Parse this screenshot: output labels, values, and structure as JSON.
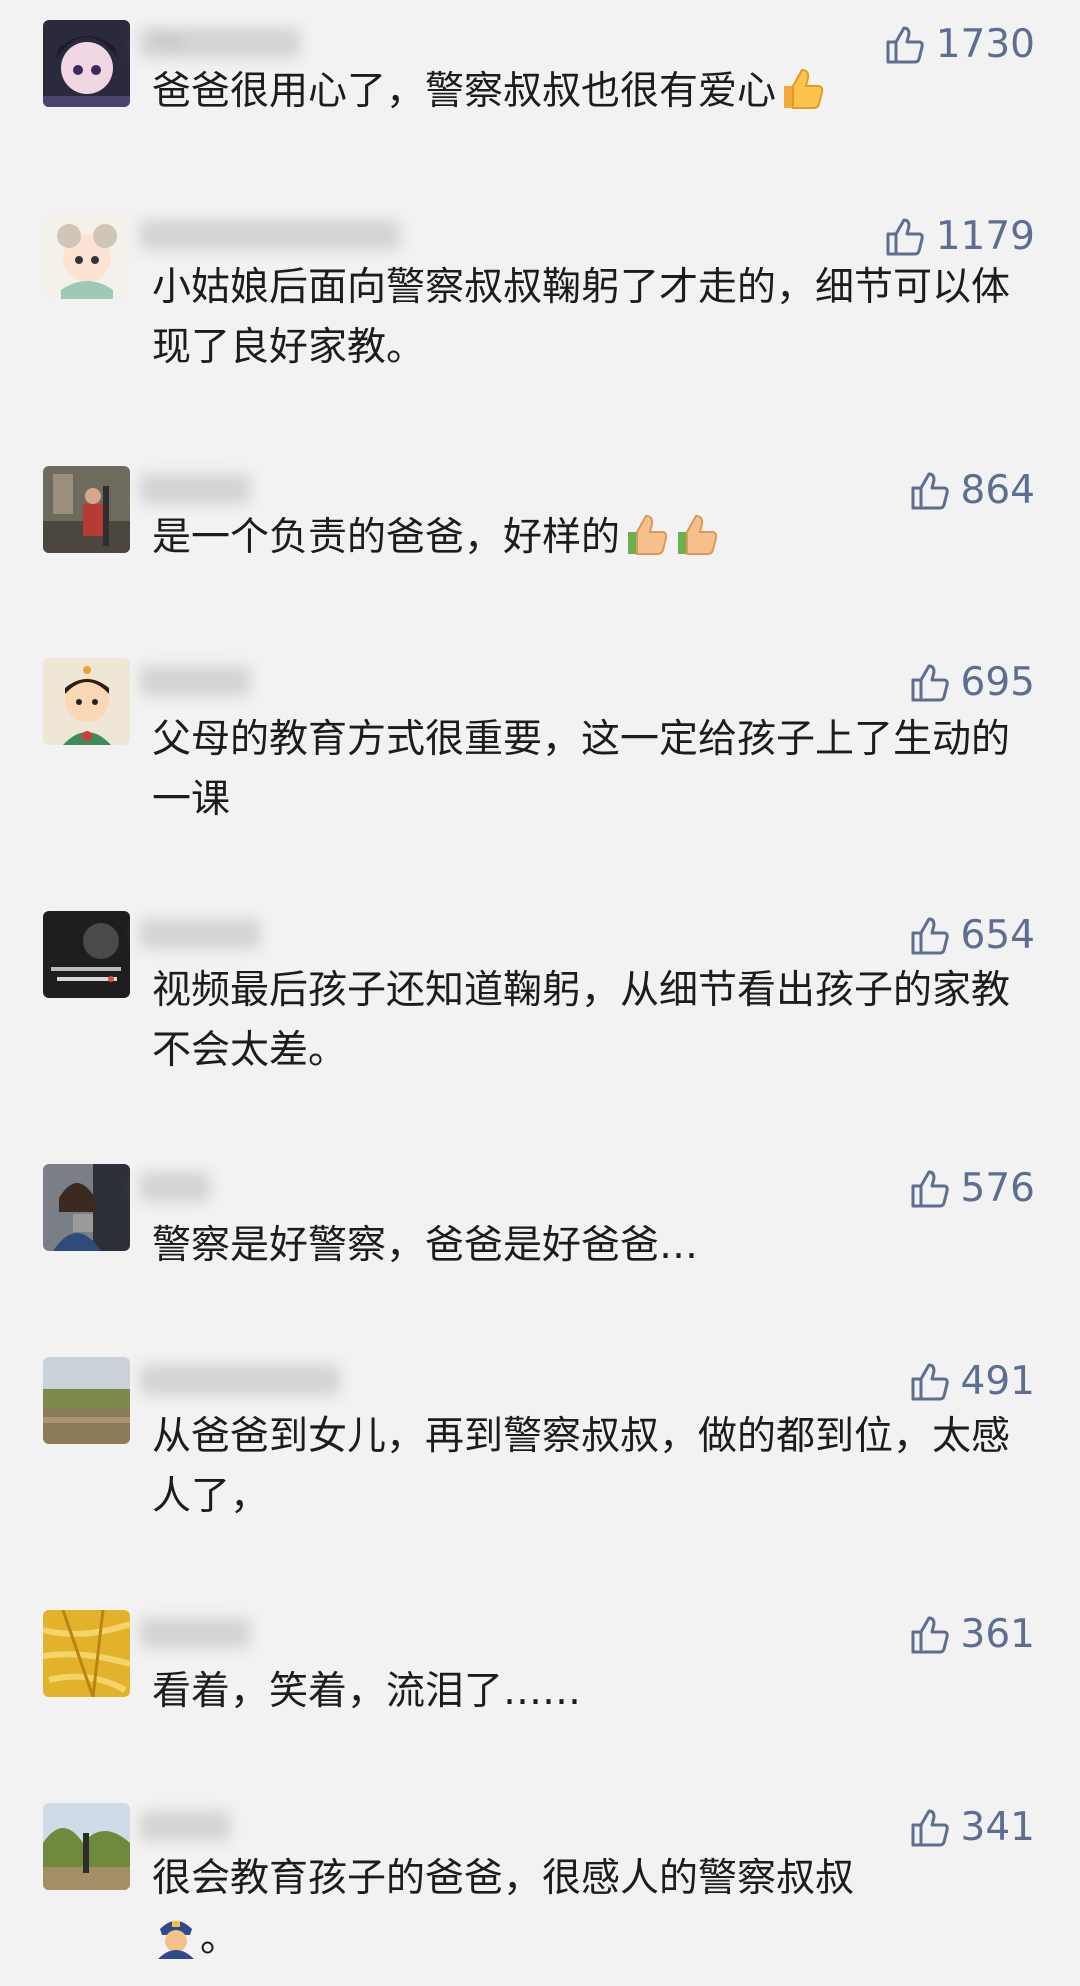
{
  "comments": [
    {
      "username": "～",
      "likes": "1730",
      "text": "爸爸很用心了，警察叔叔也很有爱心",
      "emojis": [
        "thumbs-up"
      ]
    },
    {
      "username": "",
      "likes": "1179",
      "text": "小姑娘后面向警察叔叔鞠躬了才走的，细节可以体现了良好家教。",
      "emojis": []
    },
    {
      "username": "",
      "likes": "864",
      "text": "是一个负责的爸爸，好样的",
      "emojis": [
        "thumbs-up",
        "thumbs-up"
      ]
    },
    {
      "username": "",
      "likes": "695",
      "text": "父母的教育方式很重要，这一定给孩子上了生动的一课",
      "emojis": []
    },
    {
      "username": "",
      "likes": "654",
      "text": "视频最后孩子还知道鞠躬，从细节看出孩子的家教不会太差。",
      "emojis": []
    },
    {
      "username": "",
      "likes": "576",
      "text": "警察是好警察，爸爸是好爸爸…",
      "emojis": []
    },
    {
      "username": "",
      "likes": "491",
      "text": "从爸爸到女儿，再到警察叔叔，做的都到位，太感人了，",
      "emojis": []
    },
    {
      "username": "",
      "likes": "361",
      "text": "看着，笑着，流泪了……",
      "emojis": []
    },
    {
      "username": "",
      "likes": "341",
      "text": "很会教育孩子的爸爸，很感人的警察叔叔",
      "trailing_text": "。",
      "emojis": [
        "police-officer"
      ]
    }
  ],
  "colors": {
    "background": "#f2f2f2",
    "like_accent": "#5d6e90",
    "text": "#1c1c1c"
  }
}
